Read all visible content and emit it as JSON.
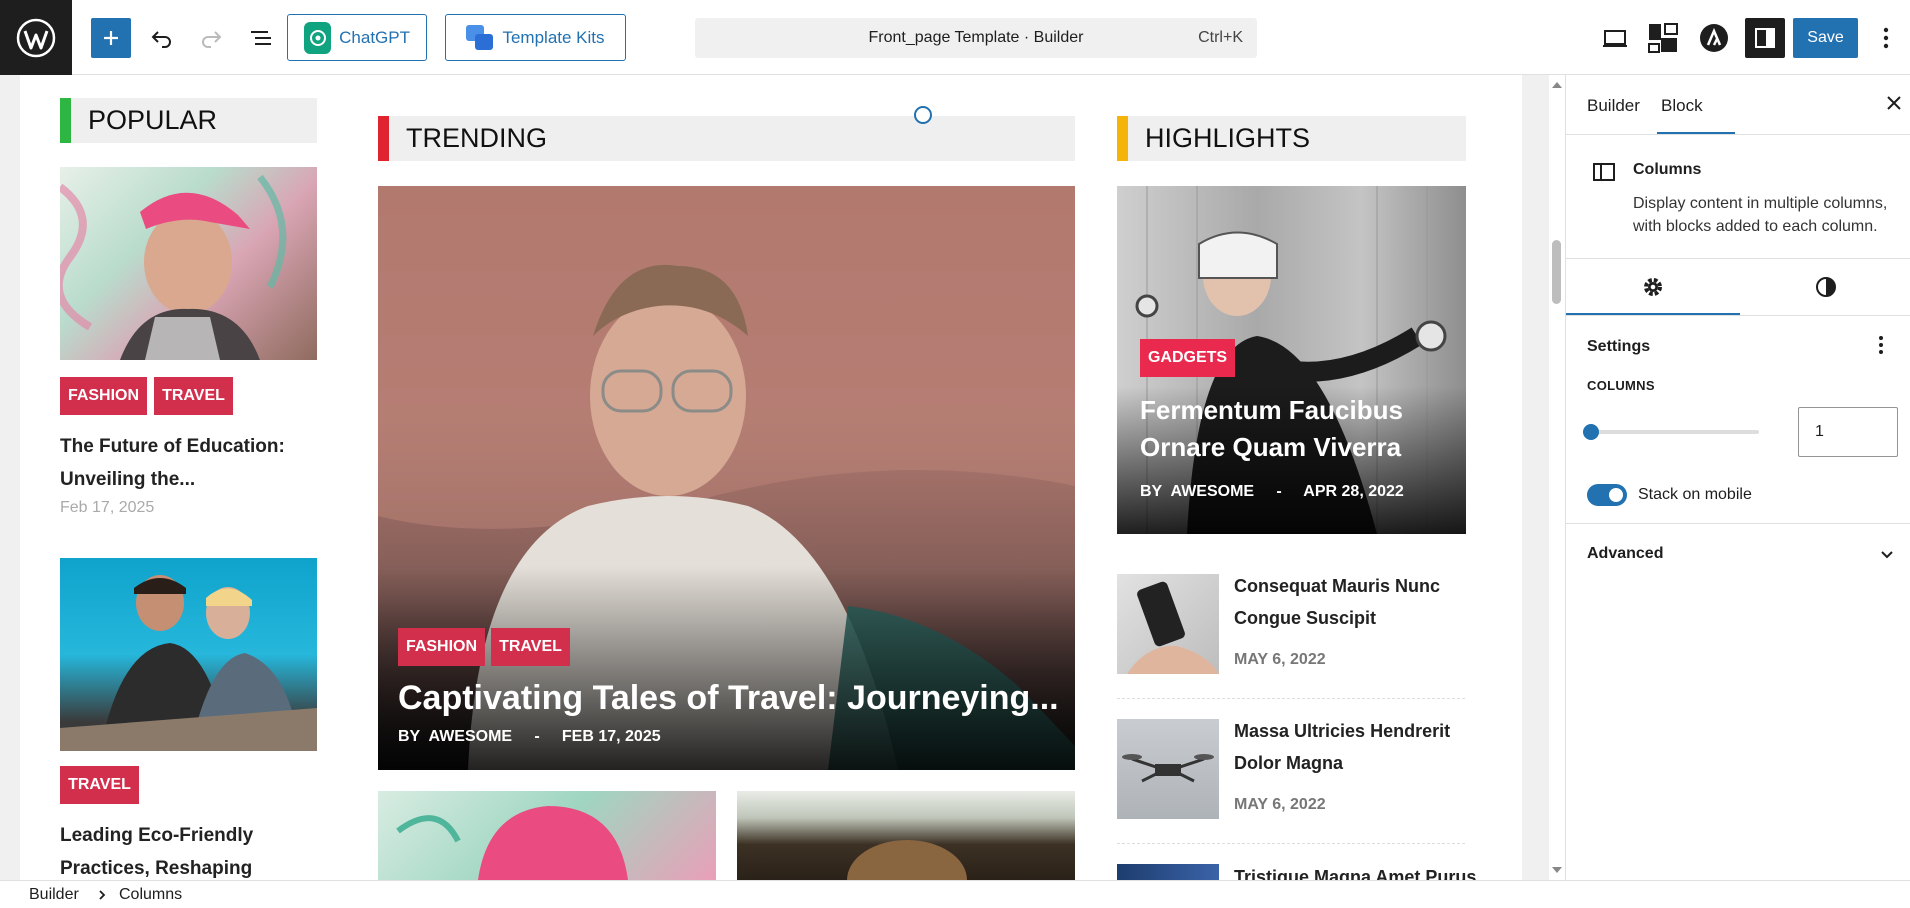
{
  "toolbar": {
    "chatgpt_label": "ChatGPT",
    "template_kits_label": "Template Kits",
    "command_title": "Front_page Template · Builder",
    "command_shortcut": "Ctrl+K",
    "save_label": "Save"
  },
  "popular": {
    "heading": "POPULAR",
    "posts": [
      {
        "tags": [
          "FASHION",
          "TRAVEL"
        ],
        "title_line1": "The Future of Education:",
        "title_line2": "Unveiling the...",
        "date": "Feb 17, 2025"
      },
      {
        "tags": [
          "TRAVEL"
        ],
        "title_line1": "Leading Eco-Friendly",
        "title_line2": "Practices, Reshaping"
      }
    ]
  },
  "trending": {
    "heading": "TRENDING",
    "tags": [
      "FASHION",
      "TRAVEL"
    ],
    "title": "Captivating Tales of Travel: Journeying...",
    "by": "BY",
    "author": "AWESOME",
    "sep": "-",
    "date": "FEB 17, 2025"
  },
  "highlights": {
    "heading": "HIGHLIGHTS",
    "feature": {
      "tag": "GADGETS",
      "title_line1": "Fermentum Faucibus",
      "title_line2": "Ornare Quam Viverra",
      "by": "BY",
      "author": "AWESOME",
      "sep": "-",
      "date": "APR 28, 2022"
    },
    "list": [
      {
        "title_line1": "Consequat Mauris Nunc",
        "title_line2": "Congue Suscipit",
        "date": "MAY 6, 2022"
      },
      {
        "title_line1": "Massa Ultricies Hendrerit",
        "title_line2": "Dolor Magna",
        "date": "MAY 6, 2022"
      },
      {
        "title_line1": "Tristique Magna Amet Purus"
      }
    ]
  },
  "sidebar": {
    "tabs": [
      "Builder",
      "Block"
    ],
    "active_tab": "Block",
    "block_name": "Columns",
    "block_desc_line1": "Display content in multiple columns,",
    "block_desc_line2": "with blocks added to each column.",
    "settings_label": "Settings",
    "columns_label": "COLUMNS",
    "columns_value": "1",
    "stack_label": "Stack on mobile",
    "stack_on": true,
    "advanced_label": "Advanced"
  },
  "breadcrumb": [
    "Builder",
    "Columns"
  ],
  "colors": {
    "accent": "#2271b1",
    "tag": "#d22f4d",
    "popular_bar": "#2db742",
    "trending_bar": "#e0242f",
    "highlights_bar": "#f5b40a"
  }
}
